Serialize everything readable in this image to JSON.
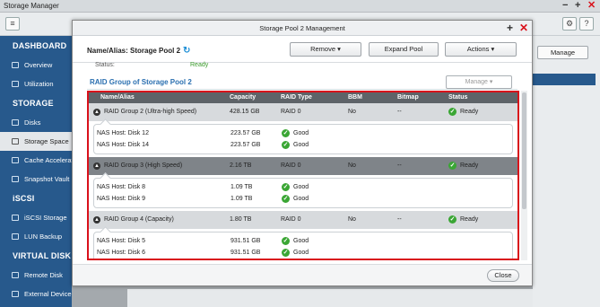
{
  "app": {
    "title": "Storage Manager"
  },
  "window_controls": {
    "min": "−",
    "max": "+",
    "close": "✕"
  },
  "toolbar": {
    "left_icon": "≡",
    "gear": "⚙",
    "help": "?"
  },
  "sidebar": {
    "sections": [
      {
        "title": "DASHBOARD",
        "items": [
          "Overview",
          "Utilization"
        ]
      },
      {
        "title": "STORAGE",
        "items": [
          "Disks",
          "Storage Space",
          "Cache Accelerat",
          "Snapshot Vault"
        ]
      },
      {
        "title": "iSCSI",
        "items": [
          "iSCSI Storage",
          "LUN Backup"
        ]
      },
      {
        "title": "VIRTUAL DISK",
        "items": [
          "Remote Disk",
          "External Device"
        ]
      }
    ],
    "active": "Storage Space"
  },
  "right_panel": {
    "manage_label": "Manage"
  },
  "dialog": {
    "title": "Storage Pool 2 Management",
    "pool_label": "Name/Alias: Storage Pool 2",
    "buttons": {
      "remove": "Remove",
      "expand": "Expand Pool",
      "actions": "Actions"
    },
    "status_label": "Status:",
    "status_value": "Ready",
    "raid_title": "RAID Group of Storage Pool 2",
    "manage_select": "Manage",
    "columns": [
      "Name/Alias",
      "Capacity",
      "RAID Type",
      "BBM",
      "Bitmap",
      "Status"
    ],
    "groups": [
      {
        "name": "RAID Group 2 (Ultra-high Speed)",
        "capacity": "428.15 GB",
        "raid": "RAID 0",
        "bbm": "No",
        "bitmap": "--",
        "status": "Ready",
        "disks": [
          {
            "name": "NAS Host: Disk 12",
            "capacity": "223.57 GB",
            "status": "Good"
          },
          {
            "name": "NAS Host: Disk 14",
            "capacity": "223.57 GB",
            "status": "Good"
          }
        ]
      },
      {
        "name": "RAID Group 3 (High Speed)",
        "capacity": "2.16 TB",
        "raid": "RAID 0",
        "bbm": "No",
        "bitmap": "--",
        "status": "Ready",
        "disks": [
          {
            "name": "NAS Host: Disk 8",
            "capacity": "1.09 TB",
            "status": "Good"
          },
          {
            "name": "NAS Host: Disk 9",
            "capacity": "1.09 TB",
            "status": "Good"
          }
        ]
      },
      {
        "name": "RAID Group 4 (Capacity)",
        "capacity": "1.80 TB",
        "raid": "RAID 0",
        "bbm": "No",
        "bitmap": "--",
        "status": "Ready",
        "disks": [
          {
            "name": "NAS Host: Disk 5",
            "capacity": "931.51 GB",
            "status": "Good"
          },
          {
            "name": "NAS Host: Disk 6",
            "capacity": "931.51 GB",
            "status": "Good"
          }
        ]
      }
    ],
    "close_label": "Close"
  },
  "colors": {
    "accent": "#27598c",
    "highlight": "#d9111b",
    "ok": "#3aa634"
  }
}
